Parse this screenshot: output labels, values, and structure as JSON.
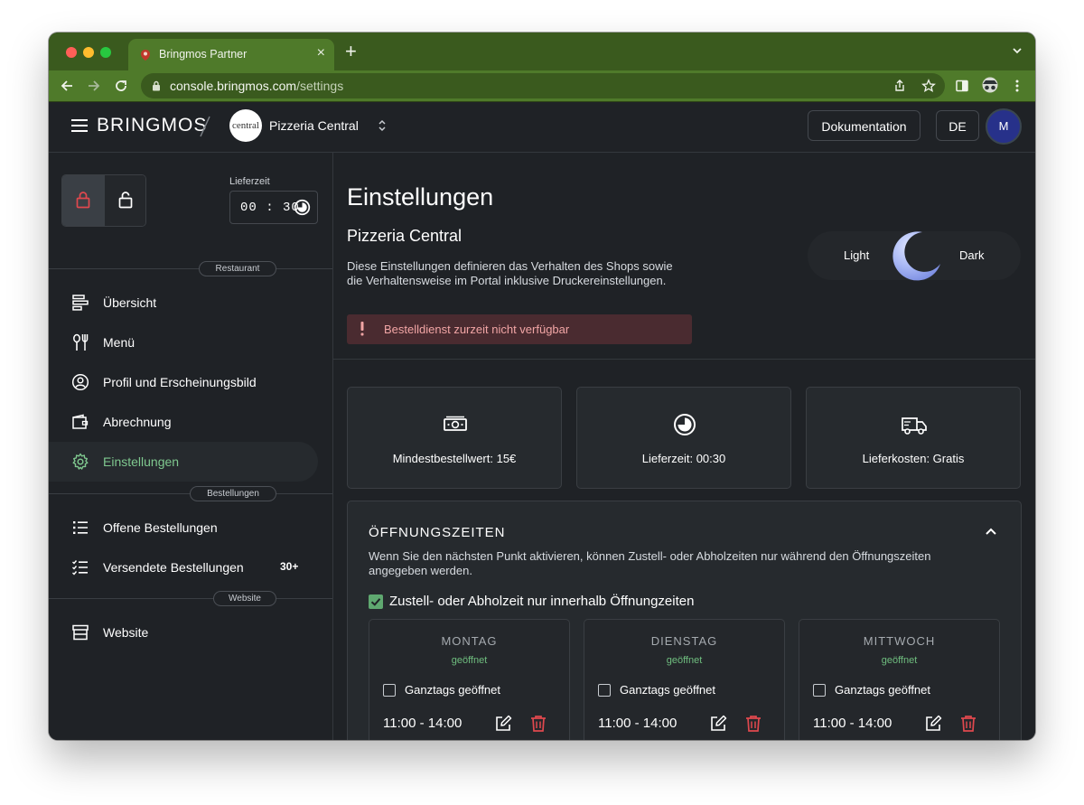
{
  "browser": {
    "tab_title": "Bringmos Partner",
    "url_host": "console.bringmos.com",
    "url_path": "/settings"
  },
  "topbar": {
    "brand": "BRINGMOS",
    "store_logo_text": "central",
    "store_name": "Pizzeria Central",
    "doc_button": "Dokumentation",
    "lang_button": "DE",
    "avatar_initial": "M"
  },
  "sidebar": {
    "delivery_time_label": "Lieferzeit",
    "delivery_time_value": "00 : 30",
    "section_restaurant": "Restaurant",
    "section_orders": "Bestellungen",
    "section_website": "Website",
    "items": [
      {
        "label": "Übersicht",
        "icon": "overview-icon"
      },
      {
        "label": "Menü",
        "icon": "cutlery-icon"
      },
      {
        "label": "Profil und Erscheinungsbild",
        "icon": "profile-icon"
      },
      {
        "label": "Abrechnung",
        "icon": "wallet-icon"
      },
      {
        "label": "Einstellungen",
        "icon": "gear-icon",
        "active": true
      },
      {
        "label": "Offene Bestellungen",
        "icon": "list-icon"
      },
      {
        "label": "Versendete Bestellungen",
        "icon": "checklist-icon",
        "badge": "30+"
      },
      {
        "label": "Website",
        "icon": "store-icon"
      }
    ]
  },
  "main": {
    "title": "Einstellungen",
    "subtitle": "Pizzeria Central",
    "description": "Diese Einstellungen definieren das Verhalten des Shops sowie die Verhaltensweise im Portal inklusive Druckereinstellungen.",
    "alert": "Bestelldienst zurzeit nicht verfügbar",
    "theme_light": "Light",
    "theme_dark": "Dark",
    "cards": [
      {
        "label": "Mindestbestellwert: 15€",
        "icon": "money-icon"
      },
      {
        "label": "Lieferzeit: 00:30",
        "icon": "clock-icon"
      },
      {
        "label": "Lieferkosten: Gratis",
        "icon": "truck-icon"
      }
    ],
    "hours": {
      "title": "ÖFFNUNGSZEITEN",
      "description": "Wenn Sie den nächsten Punkt aktivieren, können Zustell- oder Abholzeiten nur während den Öffnungszeiten angegeben werden.",
      "checkbox_label": "Zustell- oder Abholzeit nur innerhalb Öffnungzeiten",
      "days": [
        {
          "name": "MONTAG",
          "status": "geöffnet",
          "allday_label": "Ganztags geöffnet",
          "time": "11:00 - 14:00"
        },
        {
          "name": "DIENSTAG",
          "status": "geöffnet",
          "allday_label": "Ganztags geöffnet",
          "time": "11:00 - 14:00"
        },
        {
          "name": "MITTWOCH",
          "status": "geöffnet",
          "allday_label": "Ganztags geöffnet",
          "time": "11:00 - 14:00"
        }
      ]
    }
  },
  "colors": {
    "background": "#1f2226",
    "accent_green": "#7fc88f",
    "alert_bg": "#4a2b30",
    "alert_text": "#f1a5a5",
    "delete_red": "#e0484e",
    "browser_chrome": "#4f7a2a"
  }
}
